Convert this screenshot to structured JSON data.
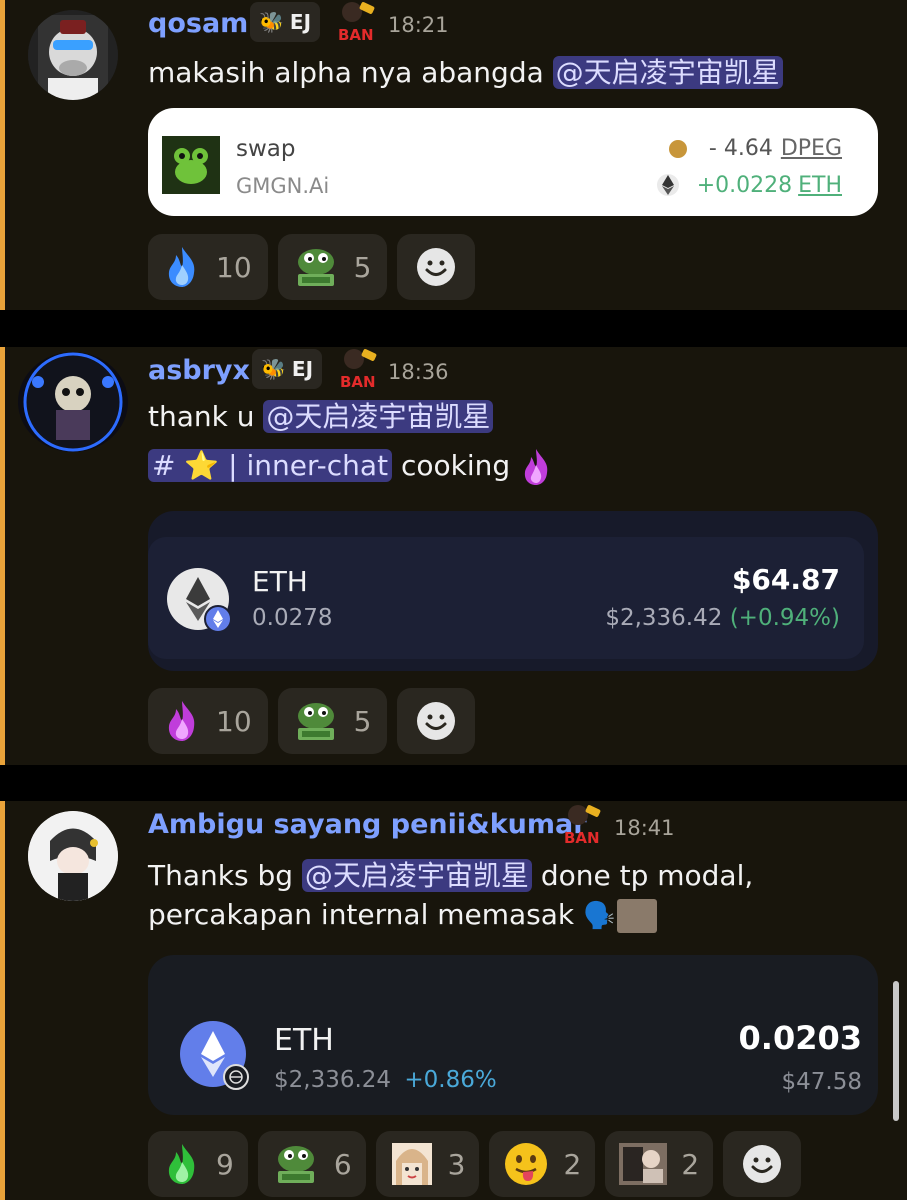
{
  "messages": [
    {
      "username": "qosam",
      "username_color": "#7ea0ff",
      "tag_label": "EJ",
      "ban_label": "BAN",
      "time": "18:21",
      "text_1": "makasih alpha nya abangda ",
      "mention": "@天启凌宇宙凯星",
      "embed": {
        "title": "swap",
        "subtitle": "GMGN.Ai",
        "row1_amount": "- 4.64",
        "row1_token": "DPEG",
        "row2_amount": "+0.0228",
        "row2_token": "ETH"
      },
      "reactions": [
        {
          "icon": "blue-flame-icon",
          "count": "10"
        },
        {
          "icon": "pepe-money-icon",
          "count": "5"
        }
      ]
    },
    {
      "username": "asbryx",
      "username_color": "#7ea0ff",
      "tag_label": "EJ",
      "ban_label": "BAN",
      "time": "18:36",
      "text_1": "thank u ",
      "mention": "@天启凌宇宙凯星",
      "channel": "# ⭐ | inner-chat",
      "text_2": " cooking ",
      "embed": {
        "symbol": "ETH",
        "amount": "0.0278",
        "value": "$64.87",
        "price": "$2,336.42",
        "change": "(+0.94%)"
      },
      "reactions": [
        {
          "icon": "purple-flame-icon",
          "count": "10"
        },
        {
          "icon": "pepe-money-icon",
          "count": "5"
        }
      ]
    },
    {
      "username": "Ambigu sayang penii&kumar",
      "username_color": "#7ea0ff",
      "ban_label": "BAN",
      "time": "18:41",
      "text_1": "Thanks bg ",
      "mention": "@天启凌宇宙凯星",
      "text_2": " done tp modal,",
      "text_3": "percakapan internal memasak ",
      "embed": {
        "symbol": "ETH",
        "price": "$2,336.24",
        "change": "+0.86%",
        "amount": "0.0203",
        "value": "$47.58"
      },
      "reactions": [
        {
          "icon": "green-flame-icon",
          "count": "9"
        },
        {
          "icon": "pepe-money-icon",
          "count": "6"
        },
        {
          "icon": "anime-girl-icon",
          "count": "3"
        },
        {
          "icon": "tongue-emoji-icon",
          "count": "2"
        },
        {
          "icon": "photo-sticker-icon",
          "count": "2"
        }
      ]
    }
  ],
  "colors": {
    "background": "#18150c",
    "accent_bar": "#e9a33a",
    "mention_bg": "#3c3a80",
    "positive": "#4fb07a",
    "eth_blue": "#627eea"
  }
}
